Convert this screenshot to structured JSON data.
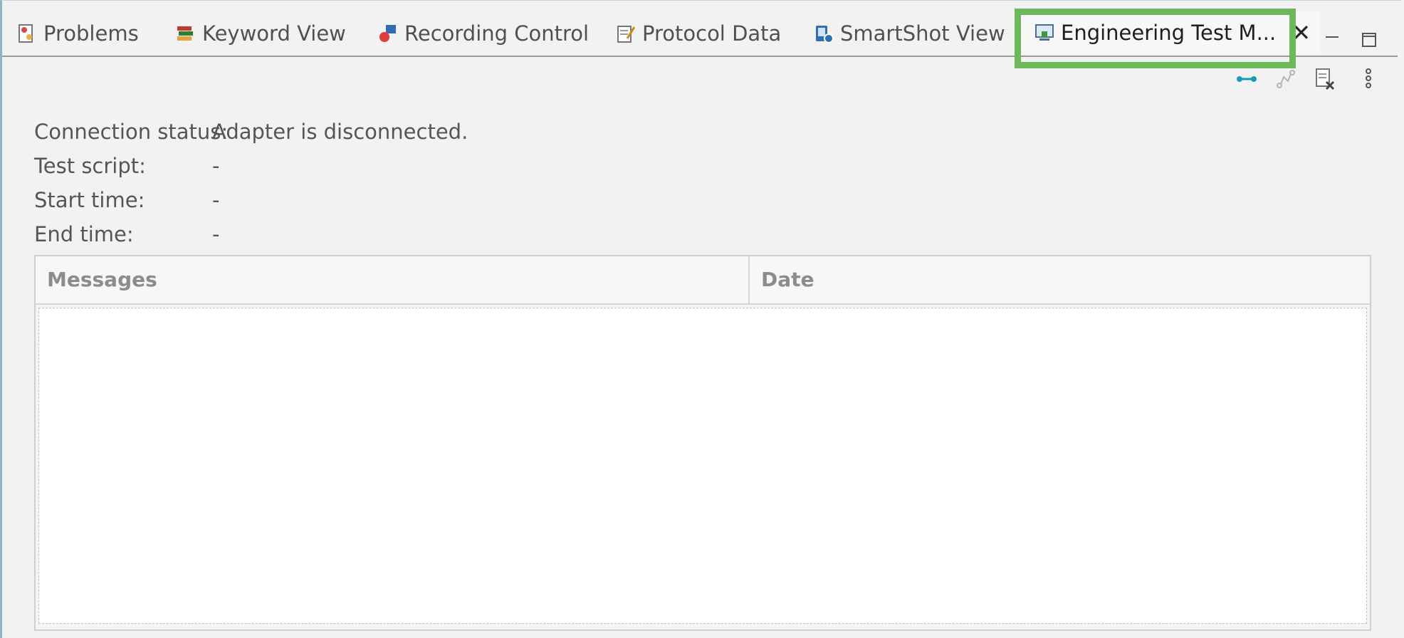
{
  "tabs": [
    {
      "label": "Problems",
      "icon": "problems-icon"
    },
    {
      "label": "Keyword View",
      "icon": "keyword-view-icon"
    },
    {
      "label": "Recording Control",
      "icon": "recording-control-icon"
    },
    {
      "label": "Protocol Data",
      "icon": "protocol-data-icon"
    },
    {
      "label": "SmartShot View",
      "icon": "smartshot-view-icon"
    },
    {
      "label": "Engineering Test M...",
      "icon": "engineering-test-monitor-icon",
      "active": true
    }
  ],
  "close_label": "✕",
  "info": {
    "connection_label": "Connection status:",
    "connection_value": "Adapter is disconnected.",
    "script_label": "Test script:",
    "script_value": "-",
    "start_label": "Start time:",
    "start_value": "-",
    "end_label": "End time:",
    "end_value": "-"
  },
  "table": {
    "columns": [
      "Messages",
      "Date"
    ],
    "rows": []
  },
  "colors": {
    "highlight": "#6db85a",
    "connect_icon": "#1a9bb5"
  }
}
